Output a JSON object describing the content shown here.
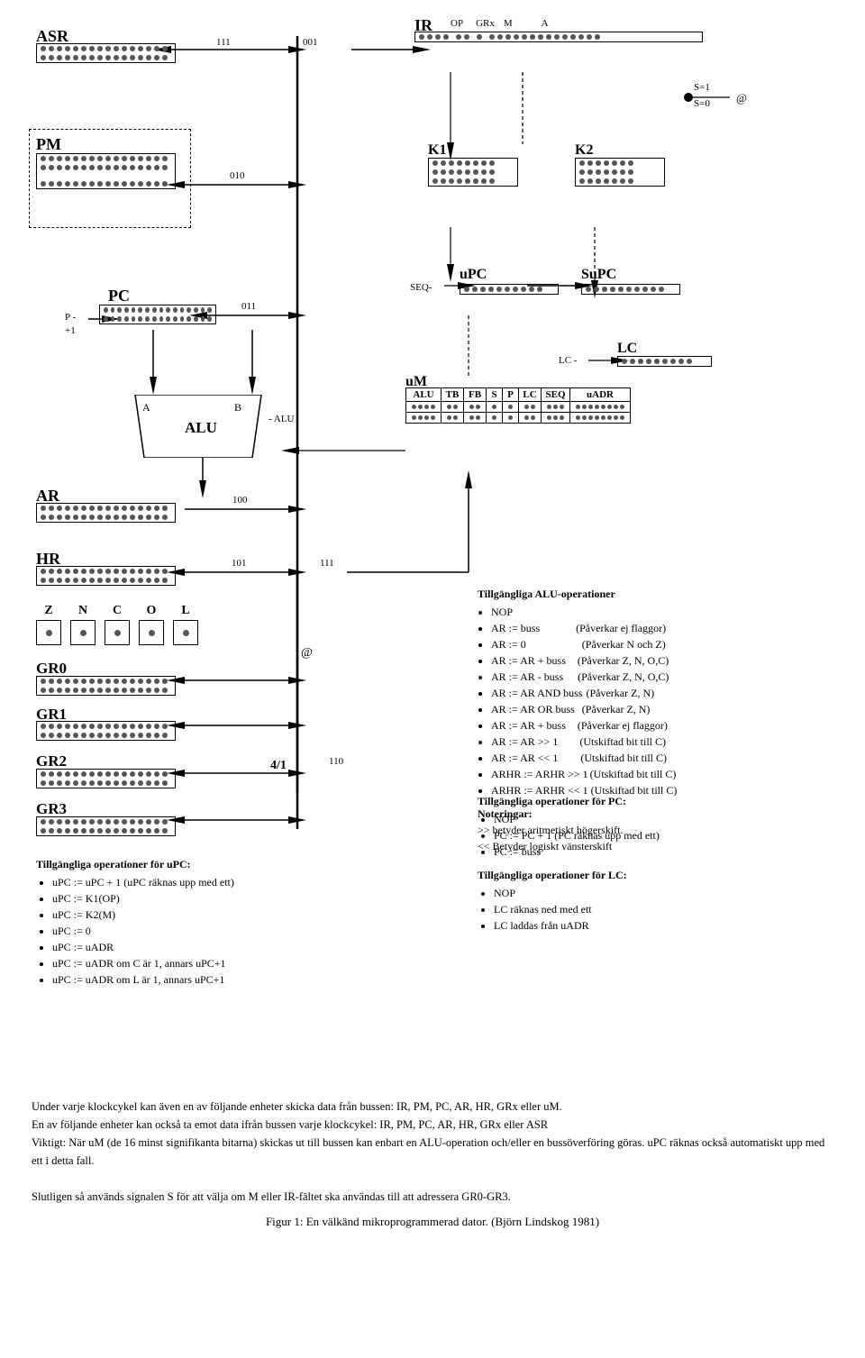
{
  "title": "Figur 1: En välkänd mikroprogrammerad dator. (Björn Lindskog 1981)",
  "registers": {
    "ASR": "ASR",
    "PM": "PM",
    "PC": "PC",
    "AR": "AR",
    "HR": "HR",
    "IR": "IR",
    "K1": "K1",
    "K2": "K2",
    "uPC": "uPC",
    "SuPC": "SuPC",
    "LC": "LC",
    "GR0": "GR0",
    "GR1": "GR1",
    "GR2": "GR2",
    "GR3": "GR3",
    "uM": "uM"
  },
  "bus_labels": {
    "b001": "001",
    "b010": "010",
    "b011": "011",
    "b100": "100",
    "b101": "101",
    "b110": "110",
    "b111a": "111",
    "b111b": "111"
  },
  "ir_fields": {
    "op": "OP",
    "grx": "GRx",
    "m": "M",
    "a": "A"
  },
  "alu_label": "ALU",
  "alu_inputs": {
    "a": "A",
    "b": "B"
  },
  "alu_control": "- ALU",
  "seq_label": "SEQ",
  "lc_label": "LC -",
  "um_headers": [
    "ALU",
    "TB",
    "FB",
    "S",
    "P",
    "LC",
    "SEQ",
    "uADR"
  ],
  "arrows": {
    "main_bus": "vertical bus",
    "p_minus": "P -",
    "plus1": "+1",
    "at_symbol_top": "@",
    "s1_label": "S=1",
    "s0_label": "S=0",
    "at_symbol_mid": "@",
    "ratio_41": "4/1",
    "seq_arrow": "SEQ-"
  },
  "alu_operations": {
    "title": "Tillgängliga ALU-operationer",
    "items": [
      "NOP",
      "AR := buss         (Påverkar ej flaggor)",
      "AR := 0            (Påverkar N och Z)",
      "AR := AR + buss    (Påverkar Z, N, O,C)",
      "AR := AR - buss    (Påverkar Z, N, O,C)",
      "AR := AR AND buss  (Påverkar Z, N)",
      "AR := AR OR buss   (Påverkar Z, N)",
      "AR := AR + buss    (Påverkar ej flaggor)",
      "AR := AR >> 1      (Utskiftad bit till C)",
      "AR := AR << 1      (Utskiftad bit till C)",
      "ARHR := ARHR >> 1  (Utskiftad bit till C)",
      "ARHR := ARHR << 1  (Utskiftad bit till C)"
    ],
    "notes_title": "Noteringar:",
    "notes": [
      ">> betyder aritmetiskt högerskift.",
      "<< Betyder logiskt vänsterskift"
    ]
  },
  "pc_operations": {
    "title": "Tillgängliga operationer för PC:",
    "items": [
      "NOP",
      "PC := PC + 1   (PC räknas upp med ett)",
      "PC := buss"
    ]
  },
  "lc_operations": {
    "title": "Tillgängliga operationer för LC:",
    "items": [
      "NOP",
      "LC räknas ned med ett",
      "LC laddas från uADR"
    ]
  },
  "upc_operations": {
    "title": "Tillgängliga operationer för uPC:",
    "items": [
      "uPC := uPC + 1 (uPC räknas upp med ett)",
      "uPC := K1(OP)",
      "uPC := K2(M)",
      "uPC := 0",
      "uPC := uADR",
      "uPC := uADR om C är 1, annars uPC+1",
      "uPC := uADR om L är 1, annars uPC+1"
    ]
  },
  "flags": [
    "Z",
    "N",
    "C",
    "O",
    "L"
  ],
  "bottom_paragraphs": [
    "Under varje klockcykel kan även en av följande enheter skicka data från bussen: IR, PM, PC, AR, HR, GRx eller uM.",
    "En av följande enheter kan också ta emot data ifrån bussen varje klockcykel: IR, PM, PC, AR, HR, GRx eller ASR",
    "Viktigt: När uM (de 16 minst signifikanta bitarna) skickas ut till bussen kan enbart en ALU-operation och/eller en bussöverföring göras. uPC räknas också automatiskt upp med ett i detta fall.",
    "Slutligen så används signalen S för att välja om M eller IR-fältet ska användas till att adressera GR0-GR3."
  ],
  "figure_caption": "Figur 1: En välkänd mikroprogrammerad dator. (Björn Lindskog 1981)"
}
